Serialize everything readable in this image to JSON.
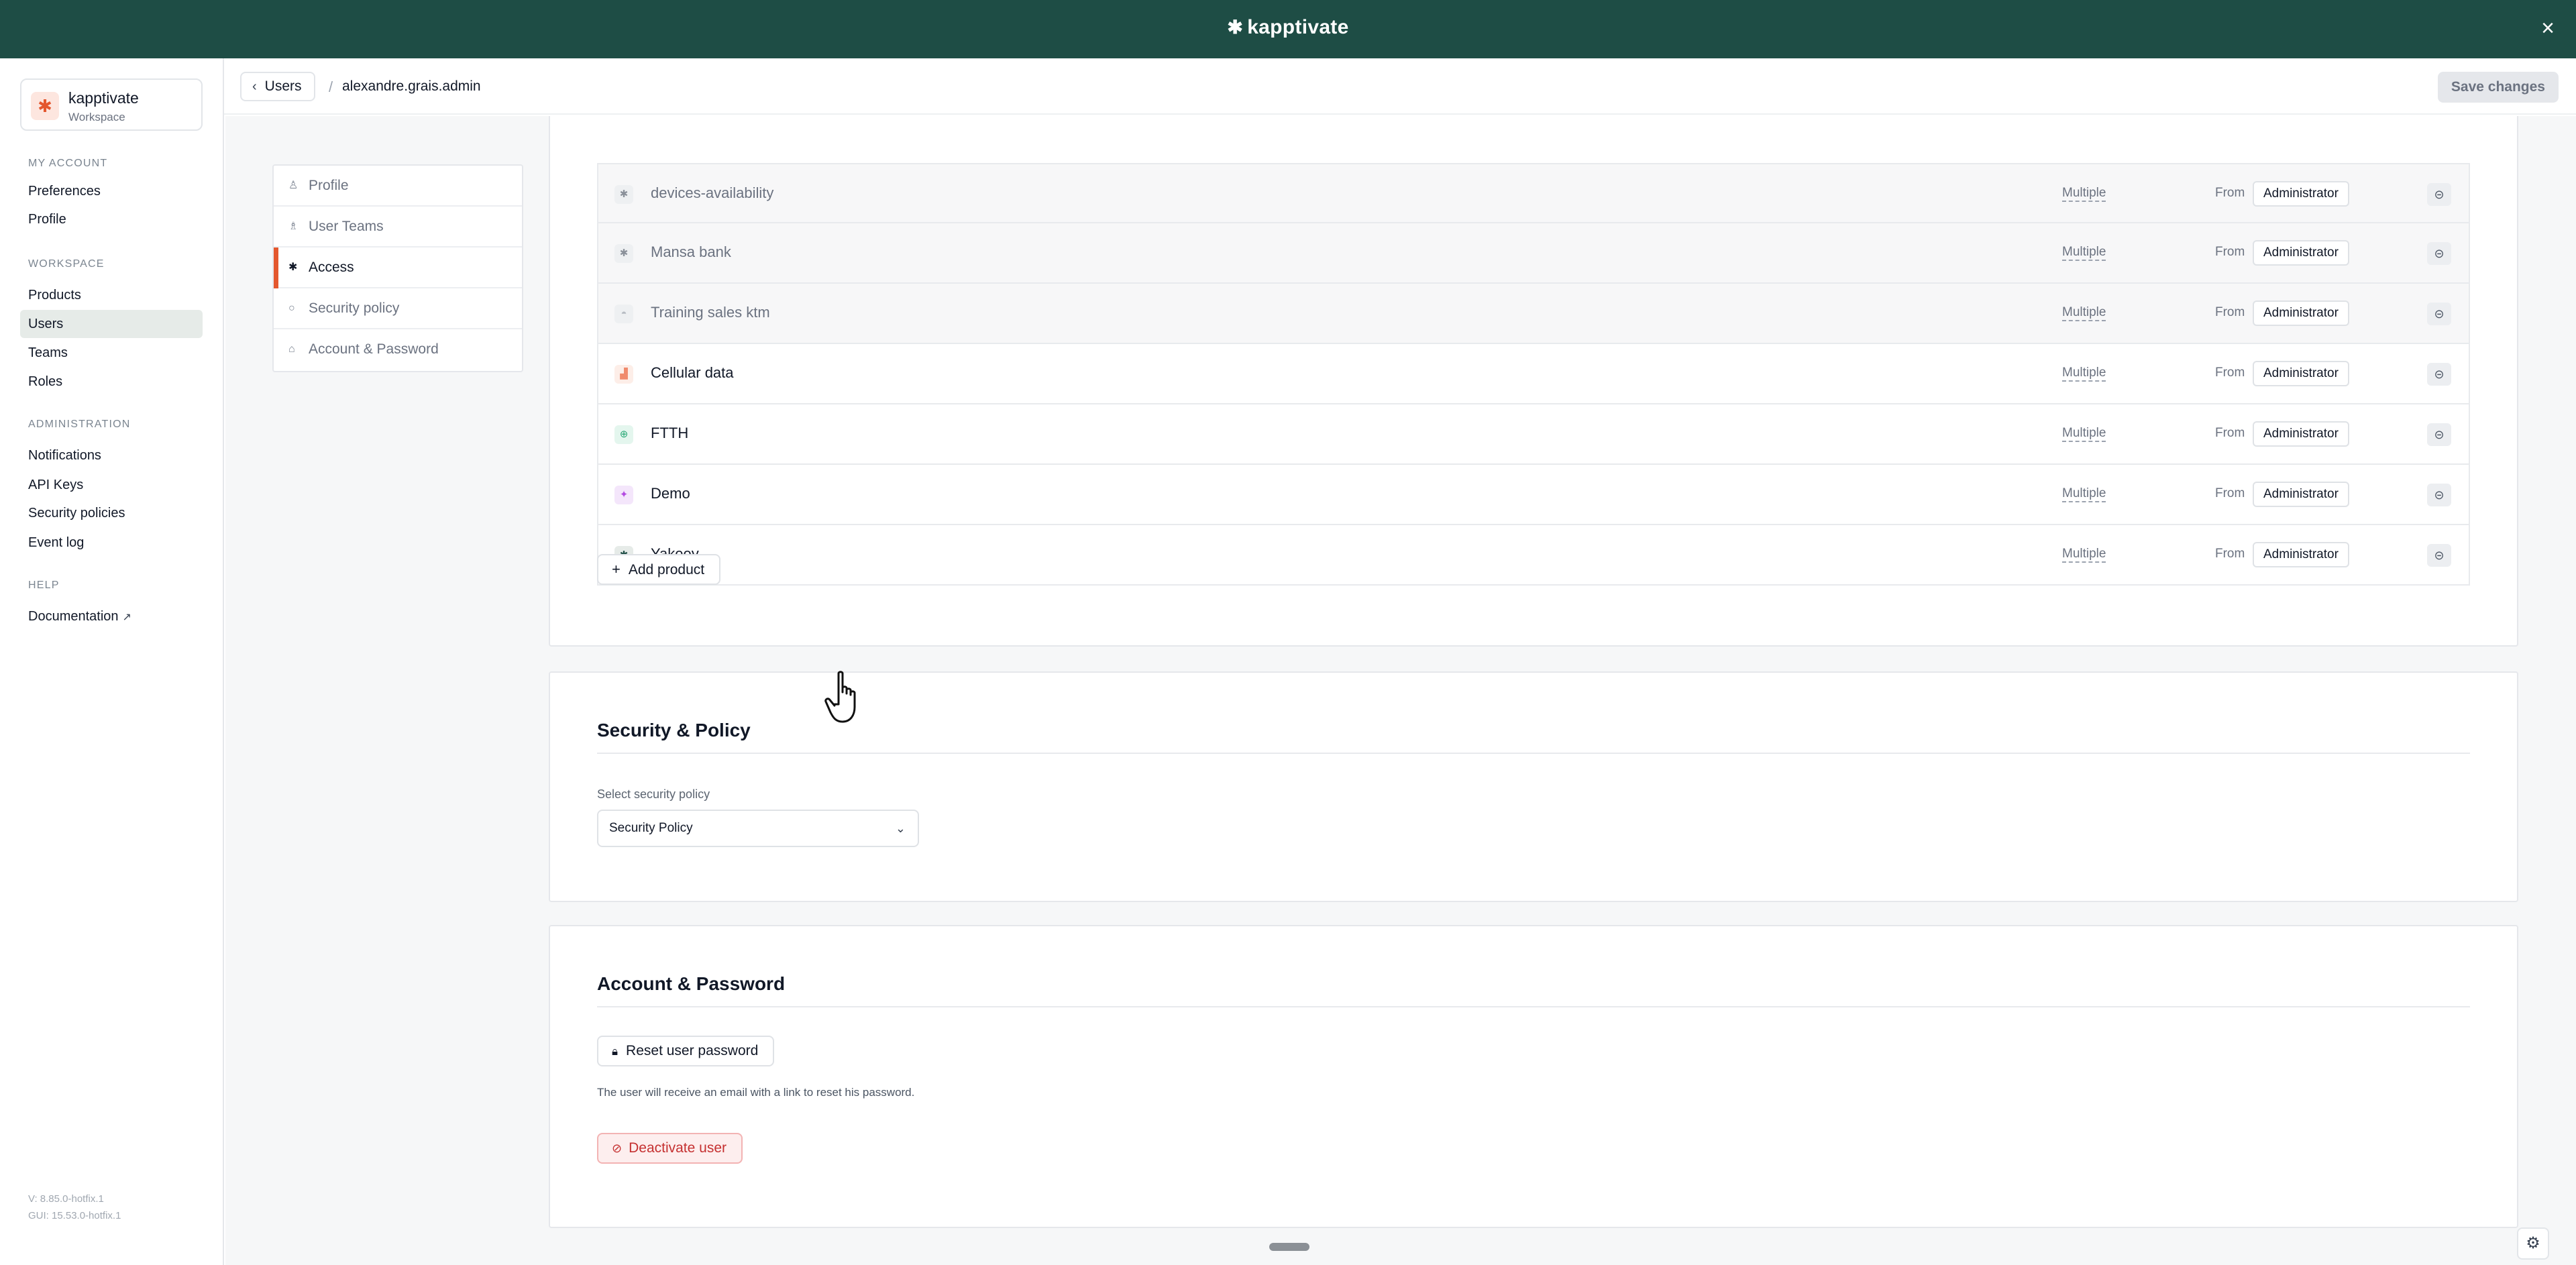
{
  "topbar": {
    "brand": "kapptivate",
    "brand_mark": "✱",
    "close_glyph": "×"
  },
  "sidebar": {
    "workspace": {
      "name": "kapptivate",
      "subtitle": "Workspace"
    },
    "sections": {
      "my_account": "MY ACCOUNT",
      "workspace": "WORKSPACE",
      "administration": "ADMINISTRATION",
      "help": "HELP"
    },
    "items": {
      "preferences": "Preferences",
      "profile": "Profile",
      "products": "Products",
      "users": "Users",
      "teams": "Teams",
      "roles": "Roles",
      "notifications": "Notifications",
      "api_keys": "API Keys",
      "security_policies": "Security policies",
      "event_log": "Event log",
      "documentation": "Documentation"
    },
    "version": "V: 8.85.0-hotfix.1",
    "gui_version": "GUI: 15.53.0-hotfix.1"
  },
  "header": {
    "back_label": "Users",
    "separator": "/",
    "current": "alexandre.grais.admin",
    "save_label": "Save changes"
  },
  "tabs": {
    "profile": "Profile",
    "user_teams": "User Teams",
    "access": "Access",
    "security_policy": "Security policy",
    "account_password": "Account & Password"
  },
  "products": {
    "rows": [
      {
        "name": "devices-availability",
        "icon": "✱",
        "icon_name": "kapptivate-icon",
        "scope": "Multiple",
        "from": "From",
        "role": "Administrator",
        "dim": true
      },
      {
        "name": "Mansa bank",
        "icon": "✱",
        "icon_name": "kapptivate-icon",
        "scope": "Multiple",
        "from": "From",
        "role": "Administrator",
        "dim": true
      },
      {
        "name": "Training sales ktm",
        "icon": "◓",
        "icon_name": "training-icon",
        "scope": "Multiple",
        "from": "From",
        "role": "Administrator",
        "dim": true
      },
      {
        "name": "Cellular data",
        "icon": "▟",
        "icon_name": "signal-icon",
        "scope": "Multiple",
        "from": "From",
        "role": "Administrator",
        "dim": false
      },
      {
        "name": "FTTH",
        "icon": "⊕",
        "icon_name": "globe-icon",
        "scope": "Multiple",
        "from": "From",
        "role": "Administrator",
        "dim": false
      },
      {
        "name": "Demo",
        "icon": "✦",
        "icon_name": "sparkle-icon",
        "scope": "Multiple",
        "from": "From",
        "role": "Administrator",
        "dim": false
      },
      {
        "name": "Yakeey",
        "icon": "✱",
        "icon_name": "kapptivate-icon",
        "scope": "Multiple",
        "from": "From",
        "role": "Administrator",
        "dim": false
      }
    ],
    "icon_colors": [
      "#8a9099",
      "#8a9099",
      "#b7bcc3",
      "#f08a6c",
      "#2aa876",
      "#b44be1",
      "#1e4d45"
    ],
    "menu_glyph": "⊝",
    "add_label": "Add product"
  },
  "security": {
    "title": "Security & Policy",
    "field_label": "Select security policy",
    "selected": "Security Policy"
  },
  "account": {
    "title": "Account & Password",
    "reset_label": "Reset user password",
    "help": "The user will receive an email with a link to reset his password.",
    "deactivate_label": "Deactivate user"
  },
  "colors": {
    "brand": "#1e4d45",
    "accent": "#e4572e",
    "danger": "#c53030"
  }
}
